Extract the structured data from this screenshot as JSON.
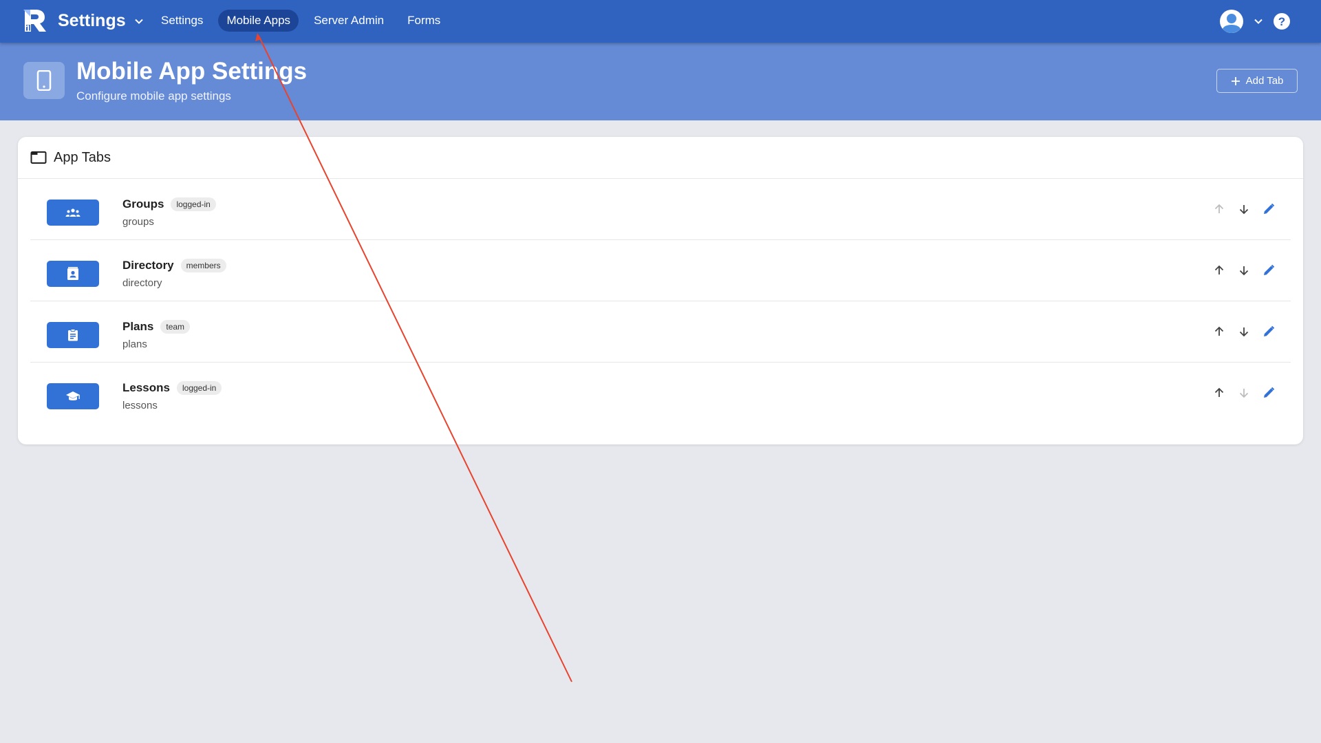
{
  "app": {
    "title": "Settings"
  },
  "nav": {
    "items": [
      {
        "label": "Settings",
        "active": false
      },
      {
        "label": "Mobile Apps",
        "active": true
      },
      {
        "label": "Server Admin",
        "active": false
      },
      {
        "label": "Forms",
        "active": false
      }
    ]
  },
  "banner": {
    "title": "Mobile App Settings",
    "subtitle": "Configure mobile app settings",
    "add_tab_label": "Add Tab"
  },
  "card": {
    "title": "App Tabs",
    "tabs": [
      {
        "name": "Groups",
        "badge": "logged-in",
        "id": "groups",
        "icon": "groups-icon",
        "up_enabled": false,
        "down_enabled": true
      },
      {
        "name": "Directory",
        "badge": "members",
        "id": "directory",
        "icon": "contact-card-icon",
        "up_enabled": true,
        "down_enabled": true
      },
      {
        "name": "Plans",
        "badge": "team",
        "id": "plans",
        "icon": "clipboard-icon",
        "up_enabled": true,
        "down_enabled": true
      },
      {
        "name": "Lessons",
        "badge": "logged-in",
        "id": "lessons",
        "icon": "graduation-cap-icon",
        "up_enabled": true,
        "down_enabled": false
      }
    ]
  },
  "colors": {
    "topbar": "#2f63bf",
    "banner": "#658ad6",
    "accent": "#3271d5",
    "nav_active": "#1c4598",
    "annotation_arrow": "#e8432d"
  }
}
